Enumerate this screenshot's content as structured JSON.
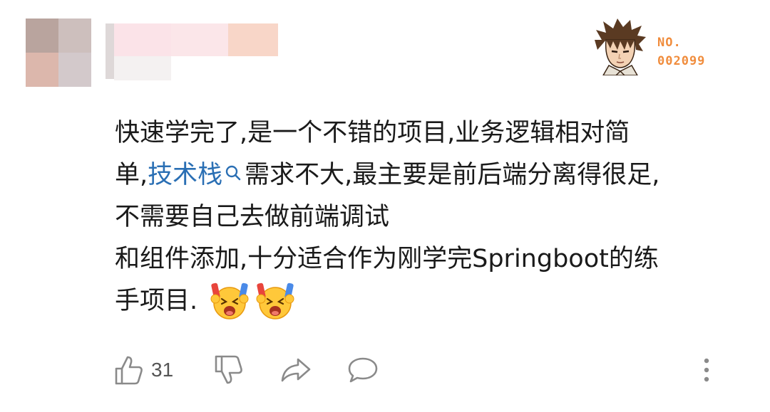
{
  "badge": {
    "no_label": "NO.",
    "number": "002099"
  },
  "comment": {
    "lines": [
      [
        {
          "text": "快速学完了,是一个不错的项目,业务逻辑相对简"
        }
      ],
      [
        {
          "text": "单,"
        },
        {
          "text": "技术栈",
          "link": true
        },
        {
          "text": "需求不大,最主要是前后端分离得很足,"
        }
      ],
      [
        {
          "text": "不需要自己去做前端调试"
        }
      ],
      [
        {
          "text": "和组件添加,十分适合作为刚学完Springboot的练"
        }
      ],
      [
        {
          "text": "手项目."
        }
      ]
    ],
    "emoji_count": 2
  },
  "actions": {
    "like_count": "31"
  },
  "colors": {
    "link": "#2a6fb4",
    "badge": "#f08c3c",
    "icon": "#8a8a8a"
  }
}
